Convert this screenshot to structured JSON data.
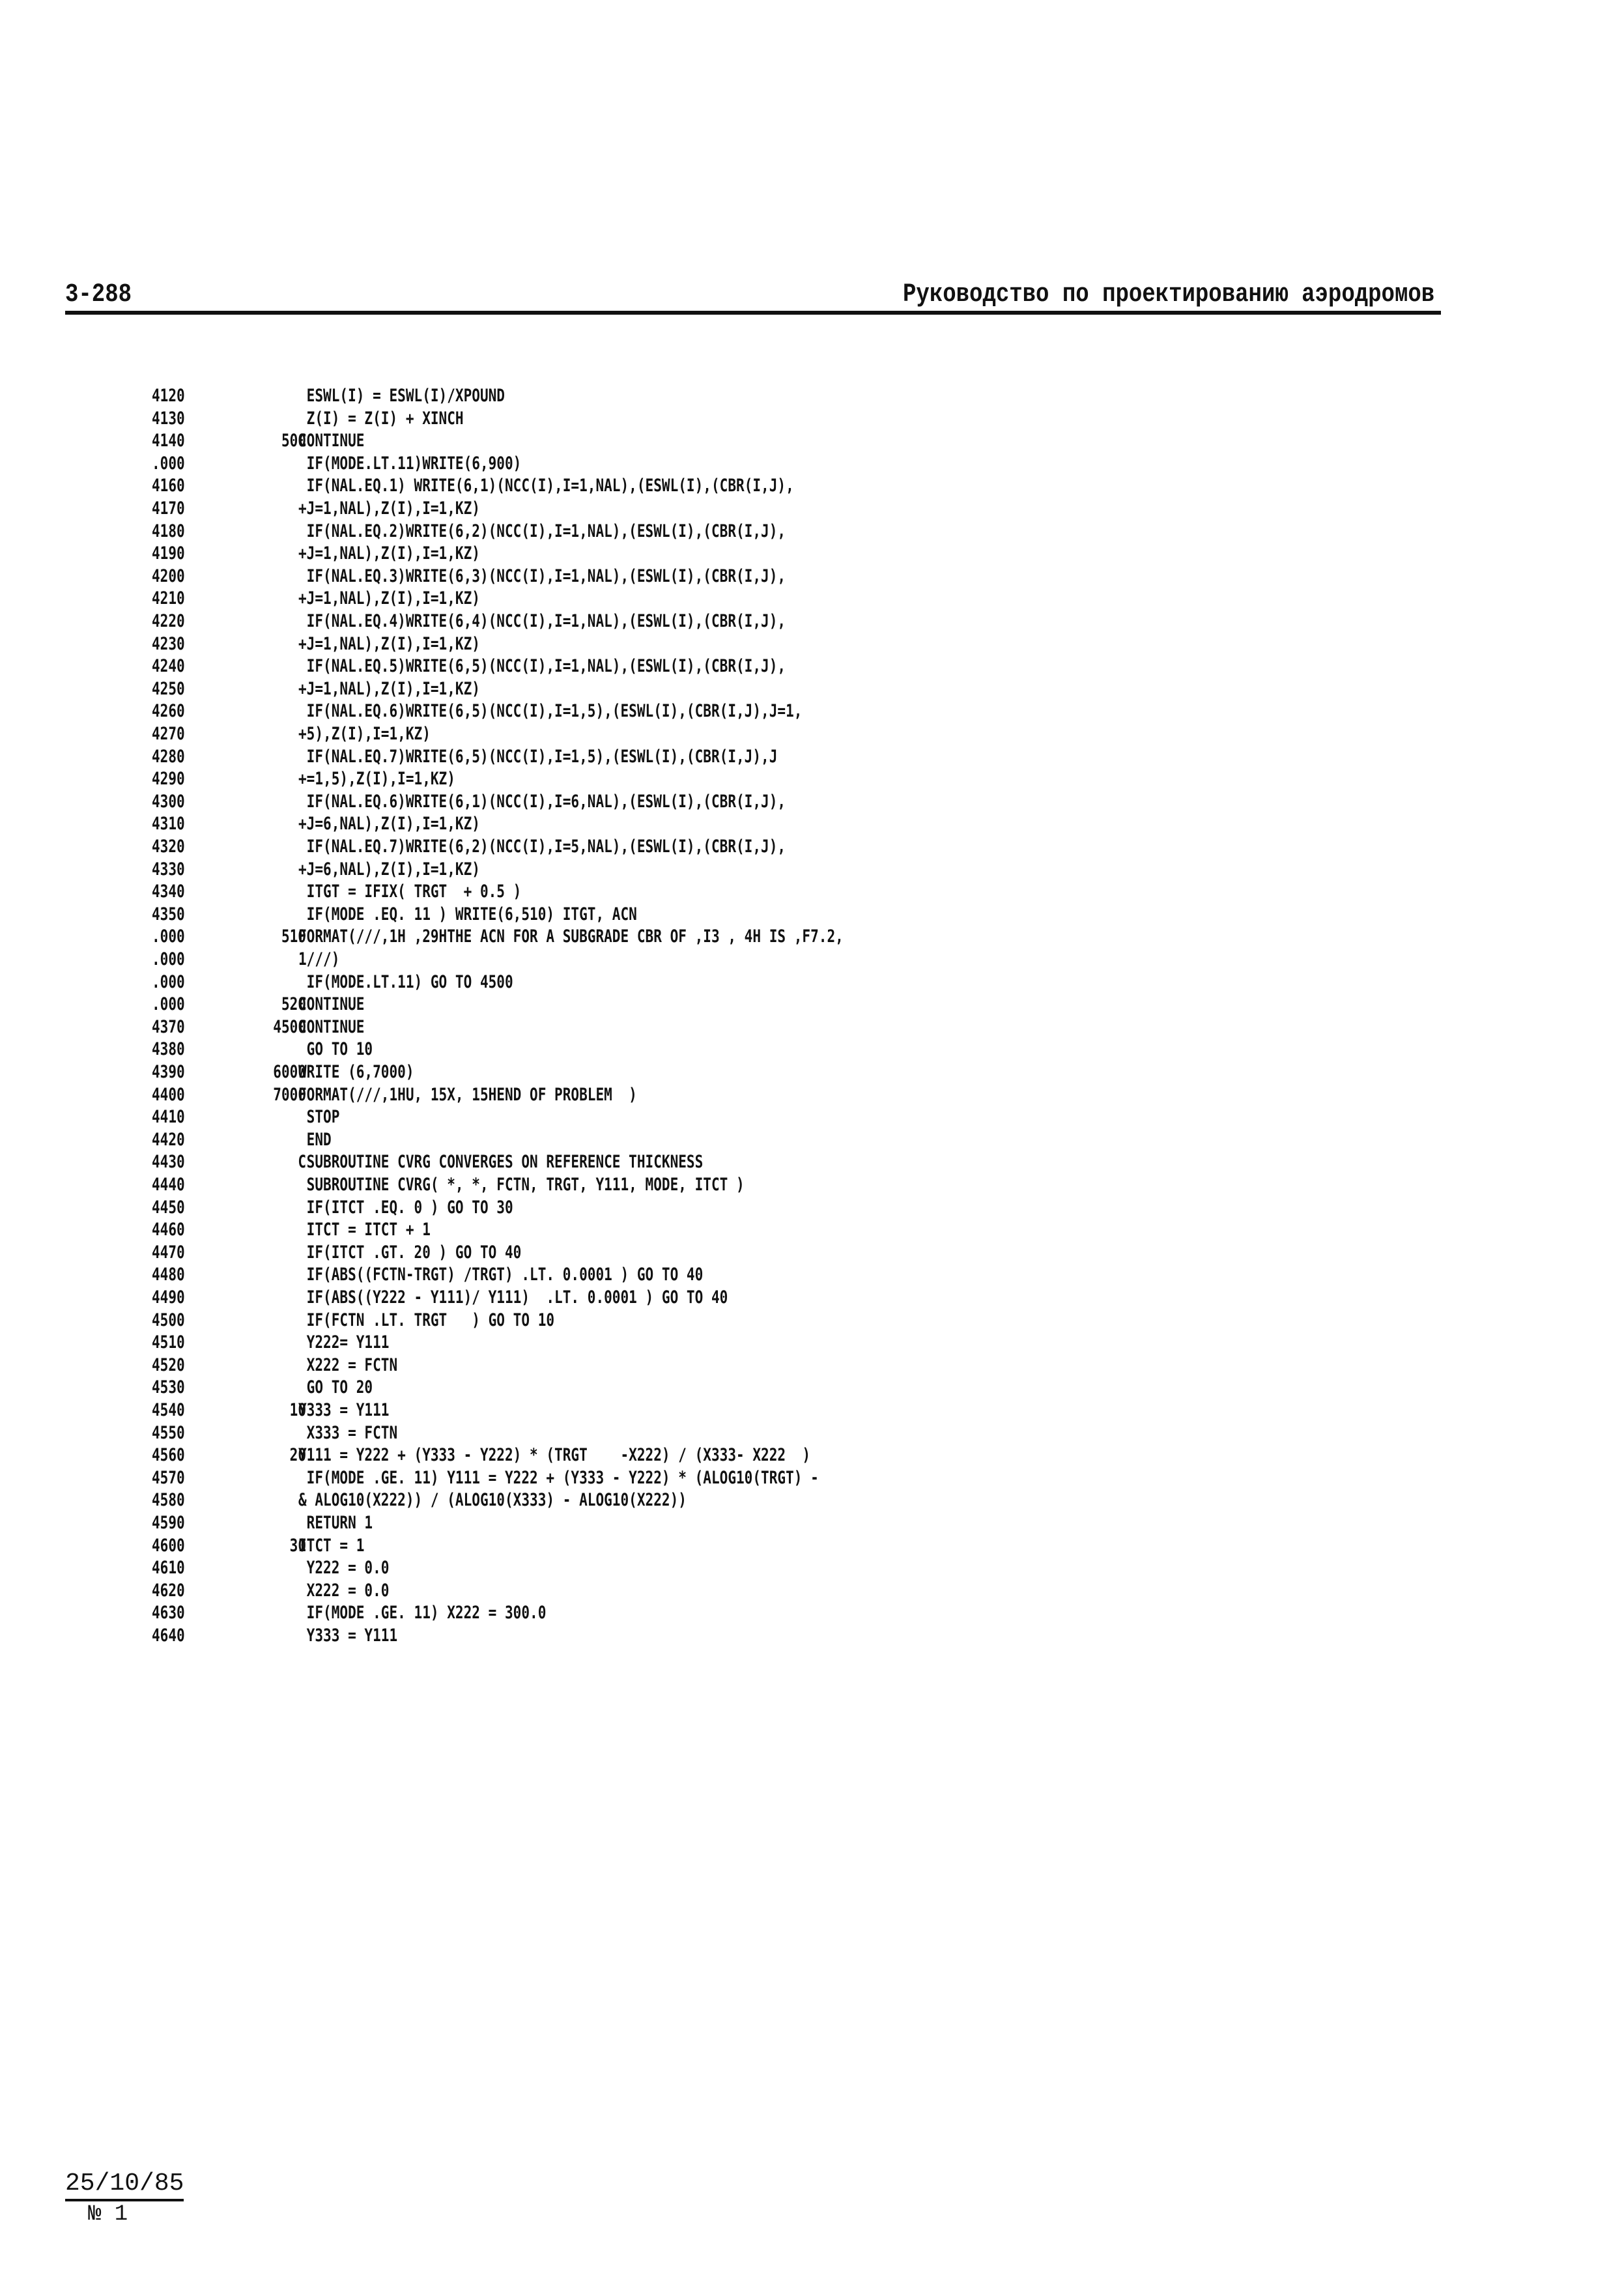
{
  "header": {
    "page_number": "3-288",
    "title": "Руководство по проектированию аэродромов"
  },
  "code_lines": [
    {
      "n": "4120",
      "label": "",
      "text": " ESWL(I) = ESWL(I)/XPOUND"
    },
    {
      "n": "4130",
      "label": "",
      "text": " Z(I) = Z(I) + XINCH"
    },
    {
      "n": "4140",
      "label": "500",
      "text": "CONTINUE"
    },
    {
      "n": ".000",
      "label": "",
      "text": " IF(MODE.LT.11)WRITE(6,900)"
    },
    {
      "n": "4160",
      "label": "",
      "text": " IF(NAL.EQ.1) WRITE(6,1)(NCC(I),I=1,NAL),(ESWL(I),(CBR(I,J),"
    },
    {
      "n": "4170",
      "label": "",
      "text": "+J=1,NAL),Z(I),I=1,KZ)"
    },
    {
      "n": "4180",
      "label": "",
      "text": " IF(NAL.EQ.2)WRITE(6,2)(NCC(I),I=1,NAL),(ESWL(I),(CBR(I,J),"
    },
    {
      "n": "4190",
      "label": "",
      "text": "+J=1,NAL),Z(I),I=1,KZ)"
    },
    {
      "n": "4200",
      "label": "",
      "text": " IF(NAL.EQ.3)WRITE(6,3)(NCC(I),I=1,NAL),(ESWL(I),(CBR(I,J),"
    },
    {
      "n": "4210",
      "label": "",
      "text": "+J=1,NAL),Z(I),I=1,KZ)"
    },
    {
      "n": "4220",
      "label": "",
      "text": " IF(NAL.EQ.4)WRITE(6,4)(NCC(I),I=1,NAL),(ESWL(I),(CBR(I,J),"
    },
    {
      "n": "4230",
      "label": "",
      "text": "+J=1,NAL),Z(I),I=1,KZ)"
    },
    {
      "n": "4240",
      "label": "",
      "text": " IF(NAL.EQ.5)WRITE(6,5)(NCC(I),I=1,NAL),(ESWL(I),(CBR(I,J),"
    },
    {
      "n": "4250",
      "label": "",
      "text": "+J=1,NAL),Z(I),I=1,KZ)"
    },
    {
      "n": "4260",
      "label": "",
      "text": " IF(NAL.EQ.6)WRITE(6,5)(NCC(I),I=1,5),(ESWL(I),(CBR(I,J),J=1,"
    },
    {
      "n": "4270",
      "label": "",
      "text": "+5),Z(I),I=1,KZ)"
    },
    {
      "n": "4280",
      "label": "",
      "text": " IF(NAL.EQ.7)WRITE(6,5)(NCC(I),I=1,5),(ESWL(I),(CBR(I,J),J"
    },
    {
      "n": "4290",
      "label": "",
      "text": "+=1,5),Z(I),I=1,KZ)"
    },
    {
      "n": "4300",
      "label": "",
      "text": " IF(NAL.EQ.6)WRITE(6,1)(NCC(I),I=6,NAL),(ESWL(I),(CBR(I,J),"
    },
    {
      "n": "4310",
      "label": "",
      "text": "+J=6,NAL),Z(I),I=1,KZ)"
    },
    {
      "n": "4320",
      "label": "",
      "text": " IF(NAL.EQ.7)WRITE(6,2)(NCC(I),I=5,NAL),(ESWL(I),(CBR(I,J),"
    },
    {
      "n": "4330",
      "label": "",
      "text": "+J=6,NAL),Z(I),I=1,KZ)"
    },
    {
      "n": "4340",
      "label": "",
      "text": " ITGT = IFIX( TRGT  + 0.5 )"
    },
    {
      "n": "4350",
      "label": "",
      "text": " IF(MODE .EQ. 11 ) WRITE(6,510) ITGT, ACN"
    },
    {
      "n": ".000",
      "label": "510",
      "text": "FORMAT(///,1H ,29HTHE ACN FOR A SUBGRADE CBR OF ,I3 , 4H IS ,F7.2,"
    },
    {
      "n": ".000",
      "label": "",
      "text": "1///)"
    },
    {
      "n": ".000",
      "label": "",
      "text": " IF(MODE.LT.11) GO TO 4500"
    },
    {
      "n": ".000",
      "label": "520",
      "text": "CONTINUE"
    },
    {
      "n": "4370",
      "label": "4500",
      "text": "CONTINUE"
    },
    {
      "n": "4380",
      "label": "",
      "text": " GO TO 10"
    },
    {
      "n": "4390",
      "label": "6000",
      "text": "WRITE (6,7000)"
    },
    {
      "n": "4400",
      "label": "7000",
      "text": "FORMAT(///,1HU, 15X, 15HEND OF PROBLEM  )"
    },
    {
      "n": "4410",
      "label": "",
      "text": " STOP"
    },
    {
      "n": "4420",
      "label": "",
      "text": " END"
    },
    {
      "n": "4430",
      "label": "C",
      "text": " SUBROUTINE CVRG CONVERGES ON REFERENCE THICKNESS"
    },
    {
      "n": "4440",
      "label": "",
      "text": " SUBROUTINE CVRG( *, *, FCTN, TRGT, Y111, MODE, ITCT )"
    },
    {
      "n": "4450",
      "label": "",
      "text": " IF(ITCT .EQ. 0 ) GO TO 30"
    },
    {
      "n": "4460",
      "label": "",
      "text": " ITCT = ITCT + 1"
    },
    {
      "n": "4470",
      "label": "",
      "text": " IF(ITCT .GT. 20 ) GO TO 40"
    },
    {
      "n": "4480",
      "label": "",
      "text": " IF(ABS((FCTN-TRGT) /TRGT) .LT. 0.0001 ) GO TO 40"
    },
    {
      "n": "4490",
      "label": "",
      "text": " IF(ABS((Y222 - Y111)/ Y111)  .LT. 0.0001 ) GO TO 40"
    },
    {
      "n": "4500",
      "label": "",
      "text": " IF(FCTN .LT. TRGT   ) GO TO 10"
    },
    {
      "n": "4510",
      "label": "",
      "text": " Y222= Y111"
    },
    {
      "n": "4520",
      "label": "",
      "text": " X222 = FCTN"
    },
    {
      "n": "4530",
      "label": "",
      "text": " GO TO 20"
    },
    {
      "n": "4540",
      "label": "10",
      "text": "Y333 = Y111"
    },
    {
      "n": "4550",
      "label": "",
      "text": " X333 = FCTN"
    },
    {
      "n": "4560",
      "label": "20",
      "text": "Y111 = Y222 + (Y333 - Y222) * (TRGT    -X222) / (X333- X222  )"
    },
    {
      "n": "4570",
      "label": "",
      "text": " IF(MODE .GE. 11) Y111 = Y222 + (Y333 - Y222) * (ALOG10(TRGT) -"
    },
    {
      "n": "4580",
      "label": "",
      "text": "& ALOG10(X222)) / (ALOG10(X333) - ALOG10(X222))"
    },
    {
      "n": "4590",
      "label": "",
      "text": " RETURN 1"
    },
    {
      "n": "4600",
      "label": "30",
      "text": "ITCT = 1"
    },
    {
      "n": "4610",
      "label": "",
      "text": " Y222 = 0.0"
    },
    {
      "n": "4620",
      "label": "",
      "text": " X222 = 0.0"
    },
    {
      "n": "4630",
      "label": "",
      "text": " IF(MODE .GE. 11) X222 = 300.0"
    },
    {
      "n": "4640",
      "label": "",
      "text": " Y333 = Y111"
    }
  ],
  "footer": {
    "date": "25/10/85",
    "issue": "№ 1"
  }
}
